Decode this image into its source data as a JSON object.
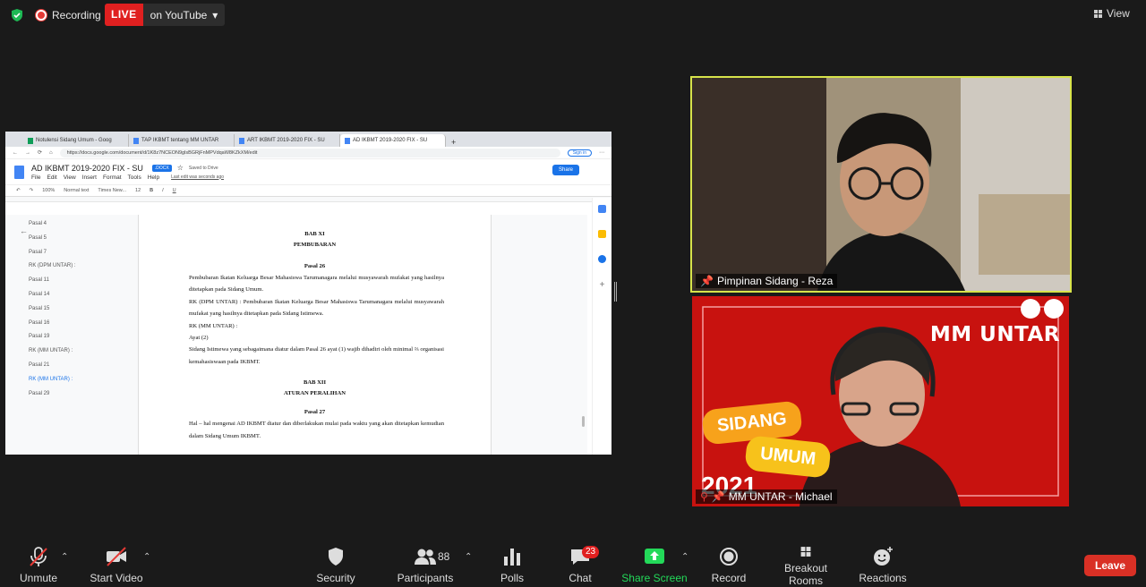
{
  "topbar": {
    "recording_label": "Recording",
    "live_label": "LIVE",
    "platform_label": "on YouTube",
    "view_label": "View"
  },
  "browser": {
    "tabs": [
      {
        "label": "Notulensi Sidang Umum - Goog"
      },
      {
        "label": "TAP IKBMT tentang MM UNTAR"
      },
      {
        "label": "ART IKBMT 2019-2020 FIX - SU"
      },
      {
        "label": "AD IKBMT 2019-2020 FIX - SU"
      }
    ],
    "url": "https://docs.google.com/document/d/1K8z7NCEON9glsBGRjFnMPVdqaW8KZkXM/edit",
    "signin_label": "Sign in"
  },
  "doc": {
    "title": "AD IKBMT 2019-2020 FIX - SU",
    "badge": ".DOCX",
    "saved": "Saved to Drive",
    "last_edit": "Last edit was seconds ago",
    "share_label": "Share",
    "menus": [
      "File",
      "Edit",
      "View",
      "Insert",
      "Format",
      "Tools",
      "Help"
    ],
    "toolbar": {
      "zoom": "100%",
      "style": "Normal text",
      "font": "Times New...",
      "size": "12"
    },
    "outline": [
      "Pasal 4",
      "Pasal 5",
      "Pasal 7",
      "RK (DPM UNTAR) :",
      "Pasal 11",
      "Pasal 14",
      "Pasal 15",
      "Pasal 16",
      "Pasal 19",
      "RK (MM UNTAR) :",
      "Pasal 21",
      "RK (MM UNTAR) :",
      "Pasal 29"
    ],
    "bab11": "BAB XI",
    "bab11_title": "PEMBUBARAN",
    "pasal26": "Pasal 26",
    "p1": "Pembubaran Ikatan Keluarga Besar Mahasiswa Tarumanagara melalui musyawarah mufakat yang hasilnya ditetapkan pada Sidang Umum.",
    "p2": "RK (DPM UNTAR) : Pembubaran Ikatan Keluarga Besar Mahasiswa Tarumanagara melalui musyawarah mufakat yang hasilnya ditetapkan pada Sidang Istimewa.",
    "p3": "RK (MM UNTAR) :",
    "p4": "Ayat (2)",
    "p5": "Sidang Istimewa yang sebagaimana diatur dalam Pasal 26 ayat (1) wajib dihadiri oleh minimal ⅔ organisasi kemahasiswaan pada IKBMT.",
    "bab12": "BAB XII",
    "bab12_title": "ATURAN PERALIHAN",
    "pasal27": "Pasal 27",
    "p6": "Hal – hal mengenai AD IKBMT diatur dan diberlakukan mulai pada waktu yang akan ditetapkan kemudian dalam Sidang Umum IKBMT."
  },
  "videos": {
    "v1_name": "Pimpinan Sidang - Reza",
    "v2_name": "MM UNTAR - Michael",
    "v2_title": "MM UNTAR",
    "v2_badge1": "SIDANG",
    "v2_badge2": "UMUM",
    "v2_year": "2021"
  },
  "toolbar": {
    "unmute": "Unmute",
    "start_video": "Start Video",
    "security": "Security",
    "participants": "Participants",
    "participants_count": "88",
    "polls": "Polls",
    "chat": "Chat",
    "chat_badge": "23",
    "share_screen": "Share Screen",
    "record": "Record",
    "breakout": "Breakout Rooms",
    "reactions": "Reactions",
    "leave": "Leave"
  },
  "colors": {
    "accent_green": "#23d959",
    "live_red": "#e02020",
    "leave_red": "#d93025",
    "speaker_border": "#d7e34a"
  }
}
